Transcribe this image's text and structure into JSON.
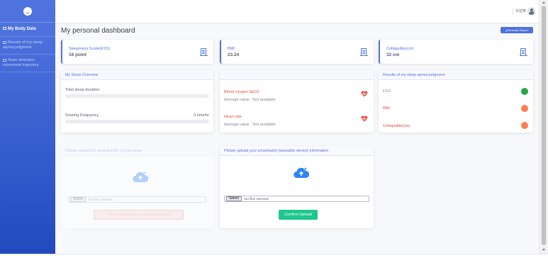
{
  "sidebar": {
    "brand_icon": "smile-icon",
    "items": [
      {
        "label": "My Body Data",
        "icon": "body-icon",
        "active": true
      },
      {
        "label": "Results of my sleep apnea judgment",
        "icon": "result-icon",
        "active": false
      },
      {
        "label": "Node detection movement trajectory",
        "icon": "trajectory-icon",
        "active": false
      }
    ]
  },
  "topbar": {
    "user_name": "林建華"
  },
  "header": {
    "title": "My personal dashboard",
    "report_button": "Generate Report"
  },
  "stats": [
    {
      "label": "Sleepiness Scale(ESS)",
      "value": "16 point",
      "icon": "building-icon"
    },
    {
      "label": "BMI",
      "value": "23.24",
      "icon": "building-icon"
    },
    {
      "label": "Collapsible(cm)",
      "value": "32 cm",
      "icon": "building-icon"
    }
  ],
  "sleep_overview": {
    "title": "My Sleep Overview",
    "total_label": "Total sleep duration",
    "total_progress": 0,
    "snoring_label": "Snoring Frequency",
    "snoring_value": "0 time/hr",
    "snoring_progress": 0
  },
  "vitals": {
    "title": "",
    "items": [
      {
        "label": "Blood oxygen SpO2",
        "sub": "Average value : Not available",
        "icon": "heart-pulse-icon"
      },
      {
        "label": "Heart rate",
        "sub": "Average value : Not available",
        "icon": "heart-pulse-icon"
      }
    ]
  },
  "apnea_results": {
    "title": "Results of my sleep apnea judgment",
    "items": [
      {
        "label": "ESS",
        "status_color": "#28a745",
        "label_color": "#858796"
      },
      {
        "label": "BMI",
        "status_color": "#fd7e50",
        "label_color": "#e74a3b"
      },
      {
        "label": "Collapsible(cm)",
        "status_color": "#fd7e50",
        "label_color": "#e74a3b"
      }
    ]
  },
  "sleep_upload": {
    "title": "Please upload the recording file of your sleep",
    "select_label": "Select",
    "file_status": "No files selected",
    "button": "Please upload your smartwatch data first"
  },
  "watch_upload": {
    "title": "Please upload your smartwatch (wearable device) information",
    "select_label": "Select",
    "file_status": "No files selected",
    "button": "Confirm Upload"
  },
  "colors": {
    "primary": "#4e73df",
    "success": "#1cc88a",
    "danger": "#e74a3b",
    "cloud": "#2f86f6"
  }
}
